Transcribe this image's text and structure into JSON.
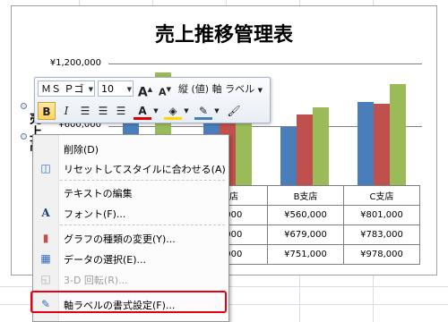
{
  "chart": {
    "title": "売上推移管理表",
    "y_axis_label": "売上高",
    "y_ticks": [
      "¥1,200,000",
      "¥600,000"
    ],
    "table": {
      "header": [
        "",
        "支店",
        "B支店",
        "C支店"
      ],
      "rows": [
        [
          "",
          "5,000",
          "¥560,000",
          "¥801,000"
        ],
        [
          "",
          "8,000",
          "¥679,000",
          "¥783,000"
        ],
        [
          "",
          "9,000",
          "¥751,000",
          "¥978,000"
        ]
      ]
    },
    "series_colors": [
      "#4a7ebb",
      "#c0504d",
      "#9bbb59"
    ]
  },
  "minibar": {
    "font_name": "ＭＳ Ｐゴ",
    "font_size": "10",
    "grow_font": "A",
    "shrink_font": "A",
    "axis_select": "縦 (値) 軸 ラベル",
    "bold": "B",
    "italic": "I",
    "font_color": "A"
  },
  "context_menu": {
    "items": [
      {
        "label": "削除(D)",
        "icon": "",
        "disabled": false
      },
      {
        "label": "リセットしてスタイルに合わせる(A)",
        "icon": "reset-style-icon",
        "disabled": false
      },
      {
        "label": "テキストの編集",
        "icon": "",
        "disabled": false
      },
      {
        "label": "フォント(F)...",
        "icon": "font-icon",
        "disabled": false
      },
      {
        "label": "グラフの種類の変更(Y)...",
        "icon": "chart-type-icon",
        "disabled": false
      },
      {
        "label": "データの選択(E)...",
        "icon": "select-data-icon",
        "disabled": false
      },
      {
        "label": "3-D 回転(R)...",
        "icon": "rotate-3d-icon",
        "disabled": true
      },
      {
        "label": "軸ラベルの書式設定(F)...",
        "icon": "format-axis-label-icon",
        "disabled": false
      }
    ]
  }
}
